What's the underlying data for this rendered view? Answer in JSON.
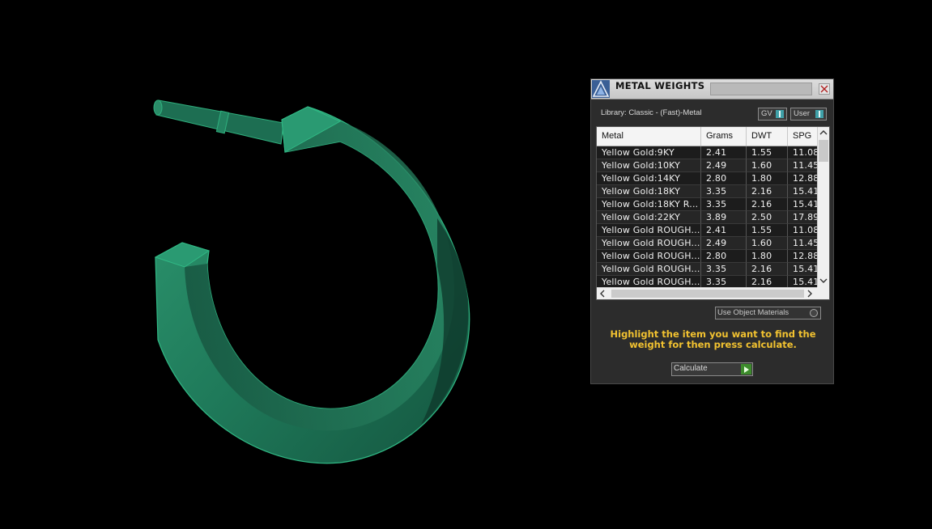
{
  "viewport": {
    "model_color": "#1f7a5a",
    "background": "#000000"
  },
  "panel": {
    "title": "METAL WEIGHTS",
    "library_label": "Library: Classic - (Fast)-Metal",
    "toggles": {
      "gv": "GV",
      "user": "User"
    },
    "table": {
      "headers": [
        "Metal",
        "Grams",
        "DWT",
        "SPG"
      ],
      "rows": [
        [
          "Yellow Gold:9KY",
          "2.41",
          "1.55",
          "11.08"
        ],
        [
          "Yellow Gold:10KY",
          "2.49",
          "1.60",
          "11.45"
        ],
        [
          "Yellow Gold:14KY",
          "2.80",
          "1.80",
          "12.88"
        ],
        [
          "Yellow Gold:18KY",
          "3.35",
          "2.16",
          "15.41"
        ],
        [
          "Yellow Gold:18KY R...",
          "3.35",
          "2.16",
          "15.41"
        ],
        [
          "Yellow Gold:22KY",
          "3.89",
          "2.50",
          "17.89"
        ],
        [
          "Yellow Gold ROUGH...",
          "2.41",
          "1.55",
          "11.08"
        ],
        [
          "Yellow Gold ROUGH...",
          "2.49",
          "1.60",
          "11.45"
        ],
        [
          "Yellow Gold ROUGH...",
          "2.80",
          "1.80",
          "12.88"
        ],
        [
          "Yellow Gold ROUGH...",
          "3.35",
          "2.16",
          "15.41"
        ],
        [
          "Yellow Gold ROUGH...",
          "3.35",
          "2.16",
          "15.41"
        ]
      ]
    },
    "use_object_materials": "Use Object Materials",
    "instructions": "Highlight the item you want to find the weight for then press calculate.",
    "calculate_label": "Calculate",
    "accent_color": "#f2c230"
  }
}
